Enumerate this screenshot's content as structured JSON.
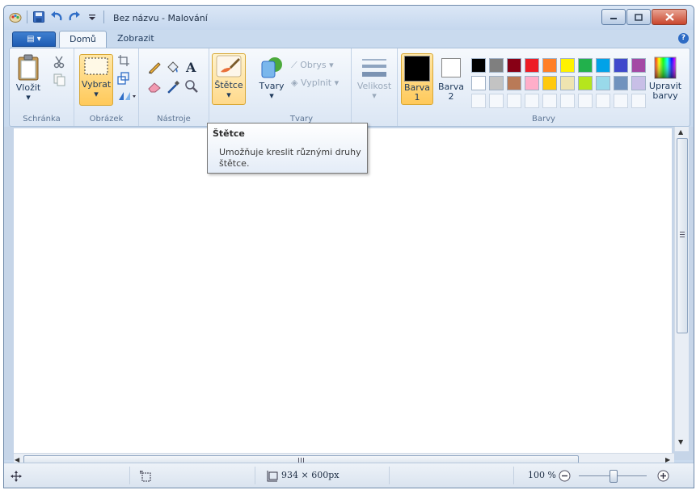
{
  "window": {
    "title": "Bez názvu - Malování"
  },
  "tabs": {
    "file_label": "▤ ▾",
    "home": "Domů",
    "view": "Zobrazit",
    "help": "?"
  },
  "ribbon": {
    "clipboard": {
      "paste": "Vložit",
      "group": "Schránka"
    },
    "image": {
      "select": "Vybrat",
      "group": "Obrázek"
    },
    "tools": {
      "group": "Nástroje"
    },
    "brushes": {
      "label": "Štětce"
    },
    "shapes": {
      "label": "Tvary",
      "outline": "Obrys",
      "fill": "Vyplnit",
      "group": "Tvary"
    },
    "size": {
      "label": "Velikost"
    },
    "colors": {
      "color1_line1": "Barva",
      "color1_line2": "1",
      "color2_line1": "Barva",
      "color2_line2": "2",
      "edit_line1": "Upravit",
      "edit_line2": "barvy",
      "group": "Barvy",
      "color1": "#000000",
      "color2": "#ffffff",
      "palette_row1": [
        "#000000",
        "#7f7f7f",
        "#880015",
        "#ed1c24",
        "#ff7f27",
        "#fff200",
        "#22b14c",
        "#00a2e8",
        "#3f48cc",
        "#a349a4"
      ],
      "palette_row2": [
        "#ffffff",
        "#c3c3c3",
        "#b97a57",
        "#ffaec9",
        "#ffc90e",
        "#efe4b0",
        "#b5e61d",
        "#99d9ea",
        "#7092be",
        "#c8bfe7"
      ]
    }
  },
  "tooltip": {
    "title": "Štětce",
    "body": "Umožňuje kreslit různými druhy štětce."
  },
  "statusbar": {
    "canvas_size": "934 × 600px",
    "zoom": "100 %"
  }
}
